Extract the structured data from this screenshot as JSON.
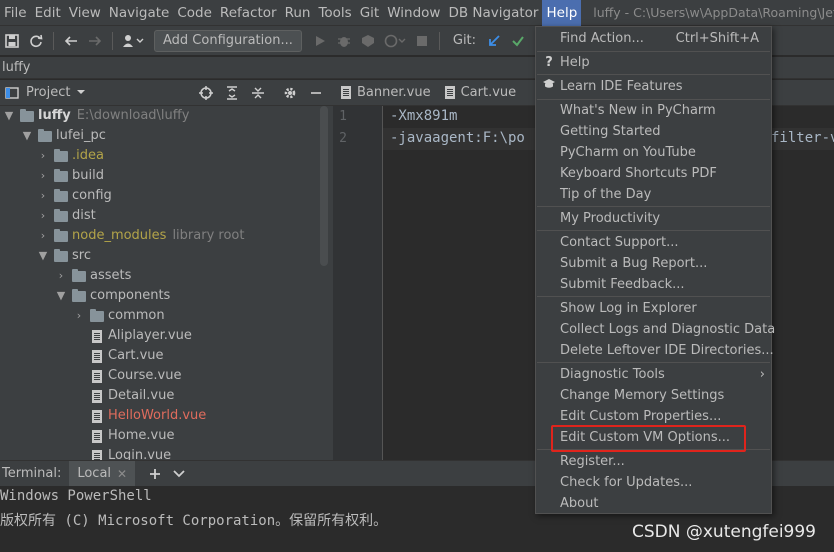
{
  "menubar": {
    "items": [
      "File",
      "Edit",
      "View",
      "Navigate",
      "Code",
      "Refactor",
      "Run",
      "Tools",
      "Git",
      "Window",
      "DB Navigator",
      "Help"
    ],
    "title_path": "luffy - C:\\Users\\w\\AppData\\Roaming\\JetB"
  },
  "toolbar": {
    "add_configuration": "Add Configuration...",
    "git_label": "Git:"
  },
  "breadcrumb": "luffy",
  "project_panel": {
    "title": "Project",
    "tree": [
      {
        "label": "luffy",
        "extra": "E:\\download\\luffy",
        "kind": "folder",
        "open": true,
        "style": "bold"
      },
      {
        "label": "lufei_pc",
        "kind": "folder",
        "open": true
      },
      {
        "label": ".idea",
        "kind": "folder",
        "style": "yellow"
      },
      {
        "label": "build",
        "kind": "folder"
      },
      {
        "label": "config",
        "kind": "folder"
      },
      {
        "label": "dist",
        "kind": "folder"
      },
      {
        "label": "node_modules",
        "extra": "library root",
        "kind": "folder",
        "style": "yellow"
      },
      {
        "label": "src",
        "kind": "folder",
        "open": true
      },
      {
        "label": "assets",
        "kind": "folder"
      },
      {
        "label": "components",
        "kind": "folder",
        "open": true
      },
      {
        "label": "common",
        "kind": "folder"
      },
      {
        "label": "Aliplayer.vue",
        "kind": "file"
      },
      {
        "label": "Cart.vue",
        "kind": "file"
      },
      {
        "label": "Course.vue",
        "kind": "file"
      },
      {
        "label": "Detail.vue",
        "kind": "file"
      },
      {
        "label": "HelloWorld.vue",
        "kind": "file",
        "style": "red"
      },
      {
        "label": "Home.vue",
        "kind": "file"
      },
      {
        "label": "Login.vue",
        "kind": "file"
      }
    ]
  },
  "editor": {
    "tabs": [
      "Banner.vue",
      "Cart.vue"
    ],
    "lines": [
      {
        "no": "1",
        "text": "-Xmx891m"
      },
      {
        "no": "2",
        "text": "-javaagent:F:\\po"
      }
    ],
    "line2_tail": "filter-v"
  },
  "terminal": {
    "title": "Terminal:",
    "tab": "Local",
    "lines": [
      "Windows PowerShell",
      "版权所有 (C) Microsoft Corporation。保留所有权利。"
    ]
  },
  "help_menu": {
    "find_action": "Find Action...",
    "find_action_shortcut": "Ctrl+Shift+A",
    "help": "Help",
    "learn": "Learn IDE Features",
    "whats_new": "What's New in PyCharm",
    "getting_started": "Getting Started",
    "youtube": "PyCharm on YouTube",
    "keymap_pdf": "Keyboard Shortcuts PDF",
    "tip": "Tip of the Day",
    "productivity": "My Productivity",
    "contact": "Contact Support...",
    "bug": "Submit a Bug Report...",
    "feedback": "Submit Feedback...",
    "show_log": "Show Log in Explorer",
    "collect_logs": "Collect Logs and Diagnostic Data",
    "delete_leftover": "Delete Leftover IDE Directories...",
    "diagnostic": "Diagnostic Tools",
    "memory": "Change Memory Settings",
    "custom_props": "Edit Custom Properties...",
    "custom_vm": "Edit Custom VM Options...",
    "register": "Register...",
    "updates": "Check for Updates...",
    "about": "About"
  },
  "watermark": "CSDN @xutengfei999",
  "colors": {
    "highlight_box": "#e0241c",
    "menu_active": "#4b6eaf"
  }
}
